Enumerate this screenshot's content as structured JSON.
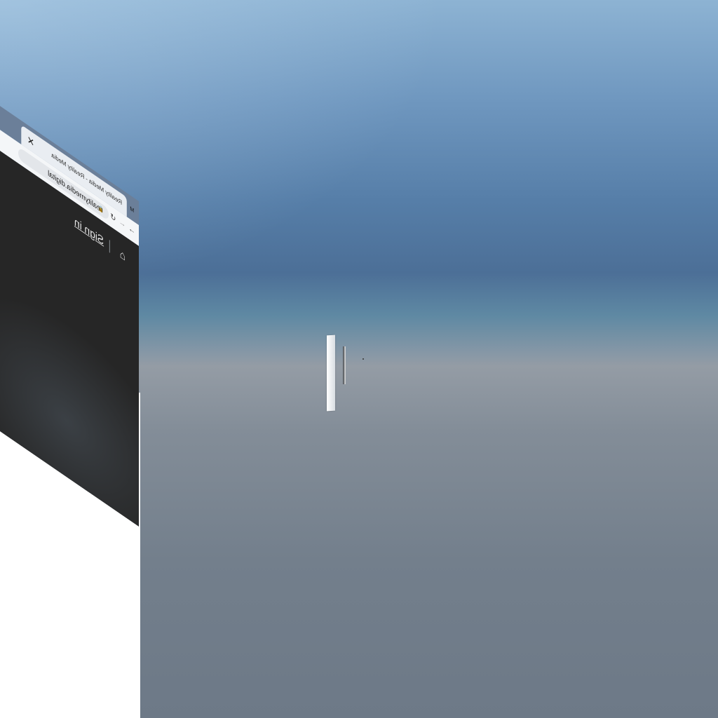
{
  "environment": {
    "description_sky_top": "#8db3d3",
    "description_horizon": "#949ca5",
    "description_ground": "#6d7987"
  },
  "browser": {
    "tab": {
      "title": "Reality Media - Reality Media",
      "favicon": "M",
      "close_label": "✕",
      "new_tab_label": "+"
    },
    "toolbar": {
      "back_label": "←",
      "forward_label": "→",
      "reload_label": "↻",
      "lock_label": "🔒",
      "url": "realitymedia.digital"
    },
    "header": {
      "home_icon": "⌂",
      "signin_label": "Sign in"
    }
  }
}
